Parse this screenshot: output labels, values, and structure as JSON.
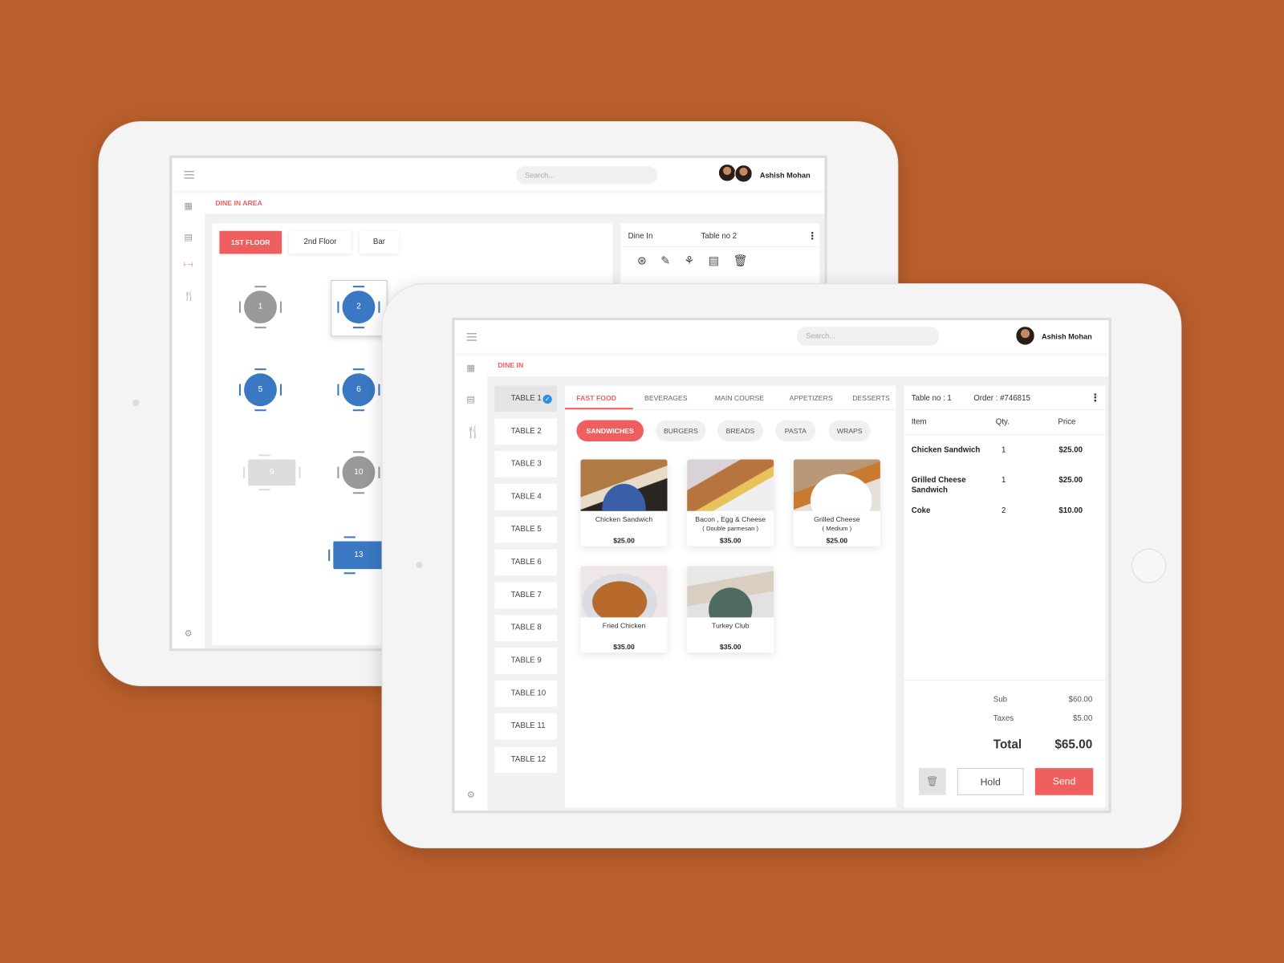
{
  "colors": {
    "background": "#BA5F2C",
    "accent": "#EF5F5F",
    "table_occupied": "#3B78C4",
    "table_free": "#999999",
    "table_reserved": "#DDDDDD"
  },
  "back": {
    "search_placeholder": "Search...",
    "user_name": "Ashish Mohan",
    "breadcrumb": "DINE IN AREA",
    "floors": [
      {
        "label": "1ST FLOOR",
        "active": true
      },
      {
        "label": "2nd Floor",
        "active": false
      },
      {
        "label": "Bar",
        "active": false
      }
    ],
    "tables": [
      {
        "label": "1",
        "status": "free",
        "shape": "round"
      },
      {
        "label": "2",
        "status": "occupied",
        "shape": "round",
        "selected": true
      },
      {
        "label": "5",
        "status": "occupied",
        "shape": "round"
      },
      {
        "label": "6",
        "status": "occupied",
        "shape": "round"
      },
      {
        "label": "9",
        "status": "reserved",
        "shape": "rect"
      },
      {
        "label": "10",
        "status": "free",
        "shape": "round"
      },
      {
        "label": "13",
        "status": "occupied",
        "shape": "rect"
      }
    ],
    "detail": {
      "type": "Dine In",
      "table": "Table no 2",
      "actions": [
        "discount-icon",
        "edit-icon",
        "waiter-icon",
        "bill-icon",
        "trash-icon"
      ]
    }
  },
  "front": {
    "search_placeholder": "Search...",
    "user_name": "Ashish Mohan",
    "breadcrumb": "DINE IN",
    "tables": [
      "TABLE 1",
      "TABLE 2",
      "TABLE 3",
      "TABLE 4",
      "TABLE 5",
      "TABLE 6",
      "TABLE 7",
      "TABLE 8",
      "TABLE 9",
      "TABLE 10",
      "TABLE 11",
      "TABLE 12"
    ],
    "selected_table": "TABLE 1",
    "categories": [
      "FAST FOOD",
      "BEVERAGES",
      "MAIN COURSE",
      "APPETIZERS",
      "DESSERTS"
    ],
    "active_category": "FAST FOOD",
    "subcategories": [
      "SANDWICHES",
      "BURGERS",
      "BREADS",
      "PASTA",
      "WRAPS"
    ],
    "active_subcategory": "SANDWICHES",
    "items": [
      {
        "name": "Chicken Sandwich",
        "sub": "",
        "price": "$25.00"
      },
      {
        "name": "Bacon , Egg & Cheese",
        "sub": "( Double parmesan )",
        "price": "$35.00"
      },
      {
        "name": "Grilled  Cheese",
        "sub": "( Medium )",
        "price": "$25.00"
      },
      {
        "name": "Fried Chicken",
        "sub": "",
        "price": "$35.00"
      },
      {
        "name": "Turkey Club",
        "sub": "",
        "price": "$35.00"
      }
    ],
    "order": {
      "table": "Table no : 1",
      "order_no": "Order : #746815",
      "columns": [
        "Item",
        "Qty.",
        "Price"
      ],
      "lines": [
        {
          "item": "Chicken Sandwich",
          "qty": "1",
          "price": "$25.00"
        },
        {
          "item": "Grilled Cheese Sandwich",
          "qty": "1",
          "price": "$25.00"
        },
        {
          "item": "Coke",
          "qty": "2",
          "price": "$10.00"
        }
      ],
      "sub_label": "Sub",
      "sub": "$60.00",
      "taxes_label": "Taxes",
      "taxes": "$5.00",
      "total_label": "Total",
      "total": "$65.00",
      "hold": "Hold",
      "send": "Send"
    }
  }
}
